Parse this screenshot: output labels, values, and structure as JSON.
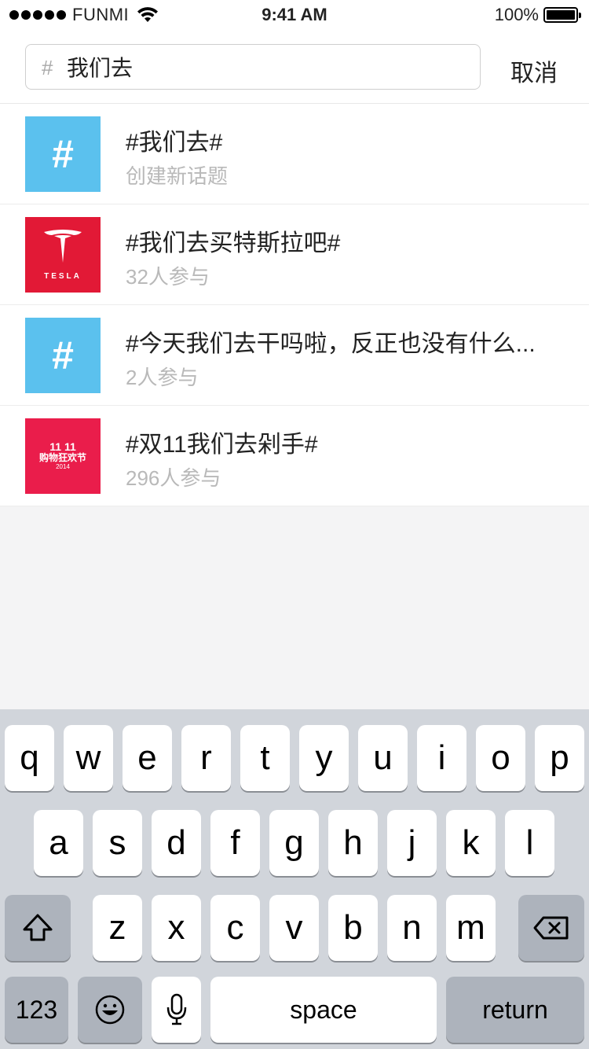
{
  "status_bar": {
    "carrier": "FUNMI",
    "time": "9:41 AM",
    "battery": "100%"
  },
  "search": {
    "hash": "#",
    "value": "我们去",
    "cancel_label": "取消"
  },
  "results": [
    {
      "thumb": "hash",
      "title": "#我们去#",
      "subtitle": "创建新话题"
    },
    {
      "thumb": "tesla",
      "title": "#我们去买特斯拉吧#",
      "subtitle": "32人参与"
    },
    {
      "thumb": "hash",
      "title": "#今天我们去干吗啦，反正也没有什么...",
      "subtitle": "2人参与"
    },
    {
      "thumb": "double11",
      "title": "#双11我们去剁手#",
      "subtitle": "296人参与"
    }
  ],
  "thumb_labels": {
    "hash": "#",
    "tesla": "TESLA",
    "d11_top": "11 11",
    "d11_mid": "购物狂欢节",
    "d11_bot": "2014"
  },
  "keyboard": {
    "row1": [
      "q",
      "w",
      "e",
      "r",
      "t",
      "y",
      "u",
      "i",
      "o",
      "p"
    ],
    "row2": [
      "a",
      "s",
      "d",
      "f",
      "g",
      "h",
      "j",
      "k",
      "l"
    ],
    "row3": [
      "z",
      "x",
      "c",
      "v",
      "b",
      "n",
      "m"
    ],
    "numbers_label": "123",
    "space_label": "space",
    "return_label": "return"
  },
  "colors": {
    "hash_thumb": "#5bc1ee",
    "tesla_red": "#e21936",
    "double11_red": "#ea1d4b"
  }
}
